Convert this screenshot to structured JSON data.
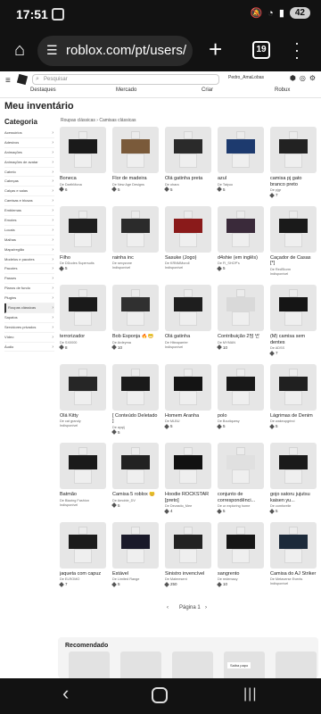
{
  "status": {
    "time": "17:51",
    "battery": "42"
  },
  "browser": {
    "url": "roblox.com/pt/users/",
    "tab_count": "19"
  },
  "topnav": {
    "search_placeholder": "Pesquisar",
    "username": "Pedro_AmaLobas",
    "links": [
      "Destaques",
      "Mercado",
      "Criar",
      "Robux"
    ]
  },
  "page_title": "Meu inventário",
  "category_title": "Categoria",
  "categories": [
    "Acessórios",
    "Adesivos",
    "Animações",
    "Animações de avatar",
    "Cabelo",
    "Cabeças",
    "Calças e saias",
    "Camisas e blusas",
    "Emblemas",
    "Emotes",
    "Locais",
    "Malhas",
    "Mapa/região",
    "Modelos e pacotes",
    "Pacotes",
    "Passes",
    "Planos de fundo",
    "Plugins",
    "Roupas clássicas",
    "Sapatos",
    "Servidores privados",
    "Vídeo",
    "Áudio"
  ],
  "active_category": "Roupas clássicas",
  "breadcrumb": "Roupas clássicas  ›  Camisas clássicas",
  "items": [
    {
      "name": "Boneca",
      "creator": "De DarthMona",
      "price": "6",
      "color": "#1a1a1a"
    },
    {
      "name": "Flor de madeira",
      "creator": "De New Age Designs",
      "price": "5",
      "color": "#7a5a3a"
    },
    {
      "name": "Olá gatinha preta",
      "creator": "De ohara",
      "price": "5",
      "color": "#2a2a2a"
    },
    {
      "name": "azul",
      "creator": "De Tatyuo",
      "price": "5",
      "color": "#1d3a6e"
    },
    {
      "name": "camisa pj gato branco preto",
      "creator": "De pjgr",
      "price": "7",
      "color": "#222222"
    },
    {
      "name": "Filho",
      "creator": "De DDudes Supersuits",
      "price": "5",
      "color": "#1e1e1e"
    },
    {
      "name": "rainha inc",
      "creator": "De sexyzone",
      "price": "",
      "creator2": "Indisponível",
      "color": "#2b2b2b"
    },
    {
      "name": "Sasuke (Jogo)",
      "creator": "De KRNMMoroll",
      "price": "",
      "creator2": "Indisponível",
      "color": "#8a1a1a"
    },
    {
      "name": "d4shie (em inglês)",
      "creator": "De FI_SHOP's",
      "price": "5",
      "color": "#3a2a3a"
    },
    {
      "name": "Caçador de Casas [*]",
      "creator": "De RedStorm",
      "price": "",
      "creator2": "Indisponível",
      "color": "#1a1a1a"
    },
    {
      "name": "terrorizador",
      "creator": "De SX0000",
      "price": "8",
      "color": "#1a1a1a"
    },
    {
      "name": "Bob Esponja 🔥😁",
      "creator": "De Ardeyma",
      "price": "10",
      "color": "#303030"
    },
    {
      "name": "Olá gatinha",
      "creator": "De Hiteaparrier",
      "price": "",
      "creator2": "Indisponível",
      "color": "#1e1e1e"
    },
    {
      "name": "Contribuição 2텀 만",
      "creator": "De MYMAN",
      "price": "10",
      "color": "#d9d9d9"
    },
    {
      "name": "(M) camisa sem dentes",
      "creator": "De ADSS",
      "price": "7",
      "color": "#151515"
    },
    {
      "name": "Olá Kitty",
      "creator": "De cat grandy",
      "price": "",
      "creator2": "Indisponível",
      "color": "#262626"
    },
    {
      "name": "[ Conteúdo Deletado ]",
      "creator": "De ayqij",
      "price": "5",
      "color": "#1a1a1a"
    },
    {
      "name": "Homem Aranha",
      "creator": "De MLBU",
      "price": "5",
      "color": "#141414"
    },
    {
      "name": "polo",
      "creator": "De Boutiquesy",
      "price": "5",
      "color": "#181818"
    },
    {
      "name": "Lágrimas de Denim",
      "creator": "De wakeupgrind",
      "price": "5",
      "color": "#202020"
    },
    {
      "name": "Batmão",
      "creator": "De Blazing Fashion",
      "price": "",
      "creator2": "Indisponível",
      "color": "#1a1a1a"
    },
    {
      "name": "Camisa 5 roblox 😊",
      "creator": "De Amoble_DV",
      "price": "5",
      "color": "#222222"
    },
    {
      "name": "Hoodie ROCKSTAR [preto]",
      "creator": "De Devastio_Mee",
      "price": "4",
      "color": "#111111"
    },
    {
      "name": "conjunto de correspondênci...",
      "creator": "De ur exploring home",
      "price": "5",
      "color": "#e0e0e0"
    },
    {
      "name": "gojo satoru jujutsu kaisen yu...",
      "creator": "De comforelle",
      "price": "5",
      "color": "#1a1a1a"
    },
    {
      "name": "jaqueta com capuz",
      "creator": "De ELROMO",
      "price": "7",
      "color": "#1b1b1b"
    },
    {
      "name": "Estável",
      "creator": "De Limited Range",
      "price": "5",
      "color": "#1a1a2a"
    },
    {
      "name": "Sinistro invencível",
      "creator": "De Maleresent",
      "price": "250",
      "color": "#222222"
    },
    {
      "name": "sangrento",
      "creator": "De redemacy",
      "price": "10",
      "color": "#161616"
    },
    {
      "name": "Camisa do AJ Striker",
      "creator": "De Metaverse Events",
      "price": "",
      "creator2": "Indisponível",
      "color": "#1c2a3a"
    }
  ],
  "pagination": {
    "prev": "‹",
    "label": "Página 1",
    "next": "›"
  },
  "recommended": {
    "title": "Recomendado",
    "tooltip": "Saiba papo"
  },
  "icons": {
    "home": "home-icon",
    "tune": "tune-icon",
    "plus": "plus-icon",
    "menu": "menu-icon",
    "search": "search-icon",
    "robux": "robux-icon",
    "gear": "gear-icon",
    "bell": "bell-icon"
  }
}
